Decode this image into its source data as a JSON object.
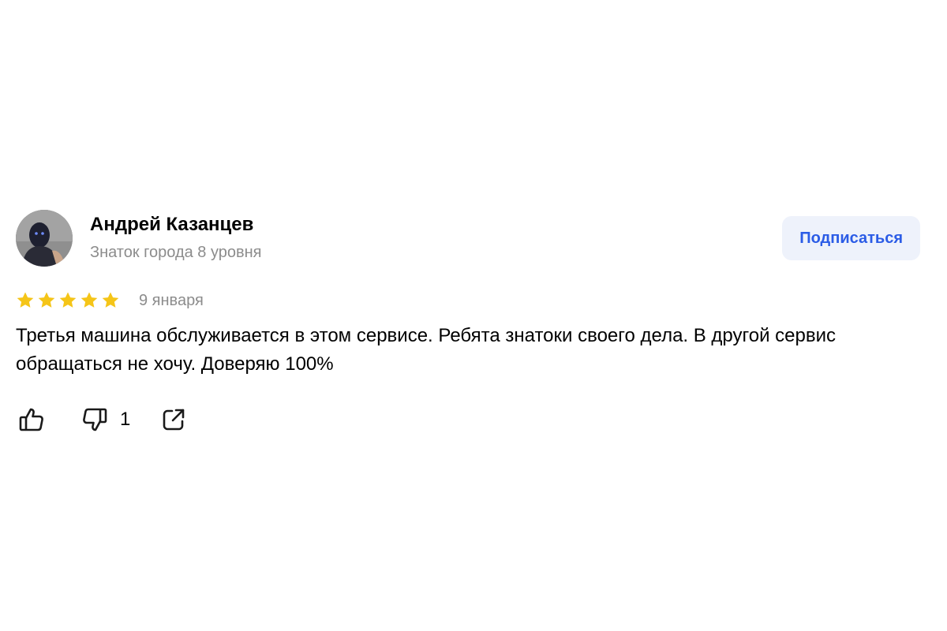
{
  "author": {
    "name": "Андрей Казанцев",
    "level": "Знаток города 8 уровня"
  },
  "subscribe_label": "Подписаться",
  "review": {
    "rating": 5,
    "date": "9 января",
    "text": "Третья машина обслуживается в этом сервисе. Ребята знатоки своего дела. В другой сервис обращаться не хочу. Доверяю 100%"
  },
  "actions": {
    "like_icon": "thumbs-up-icon",
    "dislike_icon": "thumbs-down-icon",
    "dislike_count": "1",
    "share_icon": "share-icon"
  },
  "colors": {
    "accent": "#2b5ce6",
    "button_bg": "#eef2fb",
    "star": "#f5c518",
    "muted_text": "#8c8c8c"
  }
}
